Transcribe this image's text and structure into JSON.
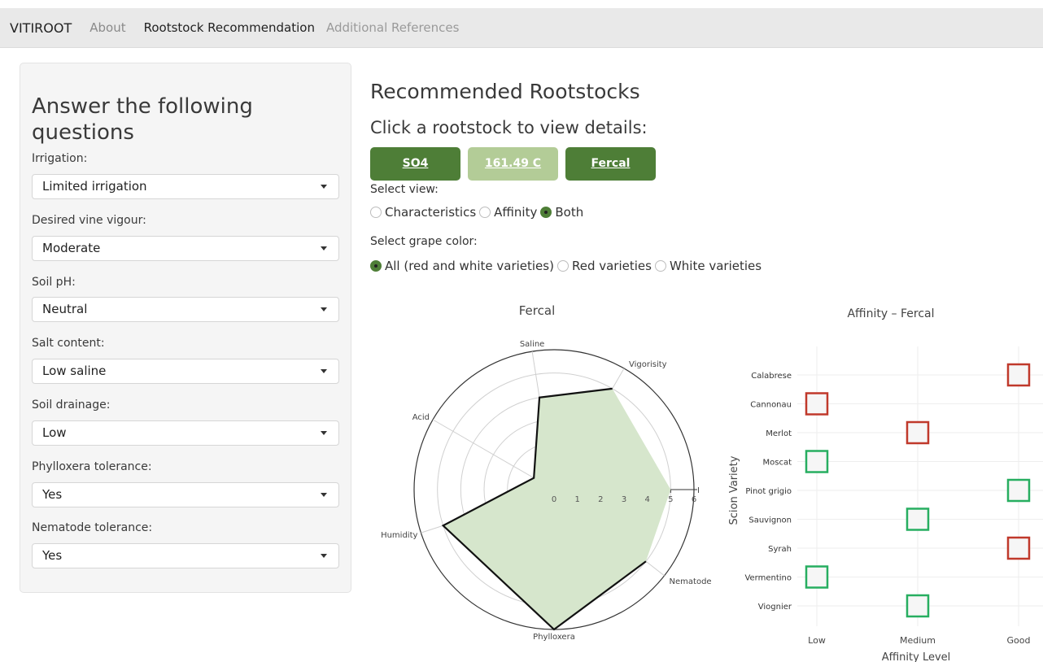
{
  "navbar": {
    "brand": "VITIROOT",
    "links": [
      "About",
      "Rootstock Recommendation",
      "Additional References"
    ]
  },
  "sidebar": {
    "title": "Answer the following questions",
    "fields": [
      {
        "label": "Irrigation:",
        "value": "Limited irrigation"
      },
      {
        "label": "Desired vine vigour:",
        "value": "Moderate"
      },
      {
        "label": "Soil pH:",
        "value": "Neutral"
      },
      {
        "label": "Salt content:",
        "value": "Low saline"
      },
      {
        "label": "Soil drainage:",
        "value": "Low"
      },
      {
        "label": "Phylloxera tolerance:",
        "value": "Yes"
      },
      {
        "label": "Nematode tolerance:",
        "value": "Yes"
      }
    ]
  },
  "main": {
    "title": "Recommended Rootstocks",
    "subtitle": "Click a rootstock to view details:",
    "rootstocks": [
      "SO4",
      "161.49 C",
      "Fercal"
    ],
    "view_label": "Select view:",
    "view_options": [
      "Characteristics",
      "Affinity",
      "Both"
    ],
    "view_selected": "Both",
    "color_label": "Select grape color:",
    "color_options": [
      "All (red and white varieties)",
      "Red varieties",
      "White varieties"
    ],
    "color_selected": "All (red and white varieties)"
  },
  "colors": {
    "accent_dark": "#4e7e37",
    "accent_light": "#b3cc97",
    "radar_fill": "#d6e6cc",
    "red_variety": "#c0392b",
    "white_variety": "#27ae60"
  },
  "chart_data": [
    {
      "type": "radar",
      "title": "Fercal",
      "axes": [
        "Vigorisity",
        "Saline",
        "Acid",
        "Humidity",
        "Phylloxera",
        "Nematode",
        "Irrigation"
      ],
      "radial_ticks": [
        "0",
        "1",
        "2",
        "3",
        "4",
        "5",
        "6"
      ],
      "range": [
        0,
        6
      ],
      "values": [
        5,
        4,
        1,
        5,
        6,
        5,
        5
      ]
    },
    {
      "type": "scatter",
      "title": "Affinity – Fercal",
      "xlabel": "Affinity Level",
      "ylabel": "Scion Variety",
      "x_categories": [
        "Low",
        "Medium",
        "Good"
      ],
      "y_categories": [
        "Calabrese",
        "Cannonau",
        "Merlot",
        "Moscat",
        "Pinot grigio",
        "Sauvignon",
        "Syrah",
        "Vermentino",
        "Viognier"
      ],
      "points": [
        {
          "variety": "Calabrese",
          "affinity": "Good",
          "color": "red"
        },
        {
          "variety": "Cannonau",
          "affinity": "Low",
          "color": "red"
        },
        {
          "variety": "Merlot",
          "affinity": "Medium",
          "color": "red"
        },
        {
          "variety": "Moscat",
          "affinity": "Low",
          "color": "white"
        },
        {
          "variety": "Pinot grigio",
          "affinity": "Good",
          "color": "white"
        },
        {
          "variety": "Sauvignon",
          "affinity": "Medium",
          "color": "white"
        },
        {
          "variety": "Syrah",
          "affinity": "Good",
          "color": "red"
        },
        {
          "variety": "Vermentino",
          "affinity": "Low",
          "color": "white"
        },
        {
          "variety": "Viognier",
          "affinity": "Medium",
          "color": "white"
        }
      ]
    }
  ]
}
